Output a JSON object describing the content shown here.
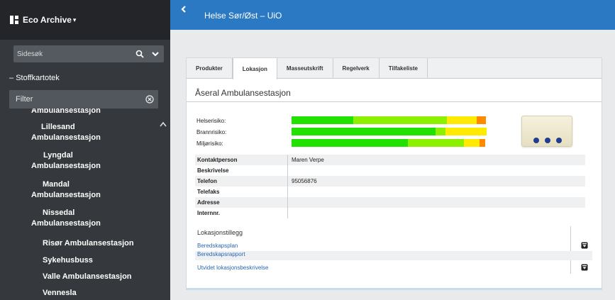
{
  "app": {
    "title": "Eco Archive"
  },
  "header": {
    "title": "Helse Sør/Øst – UiO"
  },
  "sidebar": {
    "search_placeholder": "Sidesøk",
    "section_label": "Stoffkartotek",
    "filter_label": "Filter",
    "items": [
      {
        "label": "Ambulansestasjon"
      },
      {
        "label": "Lillesand"
      },
      {
        "label": "Ambulansestasjon"
      },
      {
        "label": "Lyngdal"
      },
      {
        "label": "Ambulansestasjon"
      },
      {
        "label": "Mandal"
      },
      {
        "label": "Ambulansestasjon"
      },
      {
        "label": "Nissedal"
      },
      {
        "label": "Ambulansestasjon"
      },
      {
        "label": "Risør Ambulansestasjon"
      },
      {
        "label": "Sykehusbuss"
      },
      {
        "label": "Valle Ambulansestasjon"
      },
      {
        "label": "Vennesla"
      }
    ]
  },
  "tabs": [
    {
      "label": "Produkter"
    },
    {
      "label": "Lokasjon"
    },
    {
      "label": "Masseutskrift"
    },
    {
      "label": "Regelverk"
    },
    {
      "label": "Tilfakeliste"
    }
  ],
  "main": {
    "page_title": "Åseral Ambulansestasjon",
    "risks": [
      {
        "label": "Helserisiko:",
        "levels": [
          0.41,
          0.62,
          0.2,
          0.06
        ]
      },
      {
        "label": "Brannrisiko:",
        "levels": [
          0.74,
          0.05,
          0.21,
          0.0
        ]
      },
      {
        "label": "Miljørisiko:",
        "levels": [
          0.6,
          0.29,
          0.08,
          0.03
        ]
      }
    ],
    "info": [
      {
        "key": "Kontaktperson",
        "value": "Maren Verpe"
      },
      {
        "key": "Beskrivelse",
        "value": ""
      },
      {
        "key": "Telefon",
        "value": "95056876"
      },
      {
        "key": "Telefaks",
        "value": ""
      },
      {
        "key": "Adresse",
        "value": ""
      },
      {
        "key": "Internnr.",
        "value": ""
      }
    ],
    "attachments_title": "Lokasjonstillegg",
    "attachments": [
      {
        "label": "Beredskapsplan"
      },
      {
        "label": "Beredskapsrapport"
      },
      {
        "label": "Utvidet lokasjonsbeskrivelse"
      }
    ]
  },
  "colors": {
    "sidebar_bg": "#35383c",
    "header_bg": "#2b79c2",
    "risk_green": "#22e000",
    "risk_lightgreen": "#8df000",
    "risk_yellow": "#ffea00",
    "risk_orange": "#ff8a00",
    "link": "#2a67b1"
  }
}
